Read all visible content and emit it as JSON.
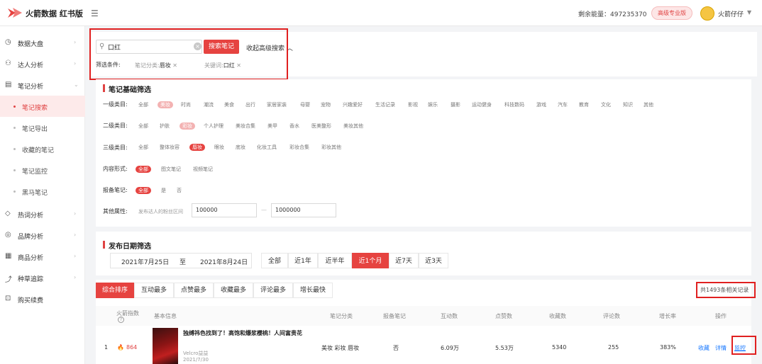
{
  "header": {
    "brand": "火箭数据 红书版",
    "energy": "剩余能量：497235370",
    "pro_badge": "高级专业版",
    "username": "火箭仔仔"
  },
  "sidebar": {
    "items": [
      {
        "label": "数据大盘",
        "icon": "dashboard-icon"
      },
      {
        "label": "达人分析",
        "icon": "user-icon"
      },
      {
        "label": "笔记分析",
        "icon": "note-icon"
      },
      {
        "label": "热词分析",
        "icon": "tag-icon"
      },
      {
        "label": "品牌分析",
        "icon": "brand-icon"
      },
      {
        "label": "商品分析",
        "icon": "shop-icon"
      },
      {
        "label": "种草追踪",
        "icon": "trend-icon"
      },
      {
        "label": "购买续费",
        "icon": "cart-icon"
      }
    ],
    "sub_items": [
      "笔记搜索",
      "笔记导出",
      "收藏的笔记",
      "笔记监控",
      "黑马笔记"
    ]
  },
  "search": {
    "value": "口红",
    "button": "搜索笔记",
    "advanced": "收起高级搜索",
    "filter_label": "筛选条件:",
    "chip1_key": "笔记分类:",
    "chip1_val": "唇妆",
    "chip2_key": "关键词:",
    "chip2_val": "口红"
  },
  "basic_filter": {
    "title": "笔记基础筛选",
    "level1_label": "一级类目:",
    "level1": [
      "全部",
      "美妆",
      "时尚",
      "潮流",
      "美食",
      "出行",
      "家居家装",
      "母婴",
      "宠物",
      "兴趣爱好",
      "生活记录",
      "影视",
      "娱乐",
      "摄影",
      "运动健身",
      "科技数码",
      "游戏",
      "汽车",
      "教育",
      "文化",
      "知识",
      "其他"
    ],
    "level2_label": "二级类目:",
    "level2": [
      "全部",
      "护肤",
      "彩妆",
      "个人护理",
      "美妆合集",
      "美甲",
      "香水",
      "医美整形",
      "美妆其他"
    ],
    "level3_label": "三级类目:",
    "level3": [
      "全部",
      "整体妆容",
      "唇妆",
      "眼妆",
      "底妆",
      "化妆工具",
      "彩妆合集",
      "彩妆其他"
    ],
    "content_label": "内容形式:",
    "content": [
      "全部",
      "图文笔记",
      "视频笔记"
    ],
    "report_label": "报备笔记:",
    "report": [
      "全部",
      "是",
      "否"
    ],
    "other_label": "其他属性:",
    "other_hint": "发布达人的粉丝区间",
    "fans_min": "100000",
    "fans_sep": "—",
    "fans_max": "1000000"
  },
  "date_filter": {
    "title": "发布日期筛选",
    "start": "2021年7月25日",
    "sep": "至",
    "end": "2021年8月24日",
    "ranges": [
      "全部",
      "近1年",
      "近半年",
      "近1个月",
      "近7天",
      "近3天"
    ]
  },
  "sort": {
    "tabs": [
      "综合排序",
      "互动最多",
      "点赞最多",
      "收藏最多",
      "评论最多",
      "增长最快"
    ],
    "total": "共1493条相关记录"
  },
  "table": {
    "headers": [
      "火箭指数",
      "基本信息",
      "笔记分类",
      "报备笔记",
      "互动数",
      "点赞数",
      "收藏数",
      "评论数",
      "增长率",
      "操作"
    ],
    "rows": [
      {
        "rank": "1",
        "score": "864",
        "title": "独缚祎色找到了！高饱和爆浆樱桃！人间富贵花",
        "author": "Velcro益益",
        "date": "2021/7/30",
        "category": "美妆 彩妆 唇妆",
        "report": "否",
        "interact": "6.09万",
        "likes": "5.53万",
        "collects": "5340",
        "comments": "255",
        "growth": "383%",
        "act_collect": "收藏",
        "act_detail": "详情",
        "act_monitor": "监控"
      }
    ]
  },
  "colors": {
    "accent": "#e64340",
    "annotation": "#e02020",
    "link": "#1677ff"
  }
}
